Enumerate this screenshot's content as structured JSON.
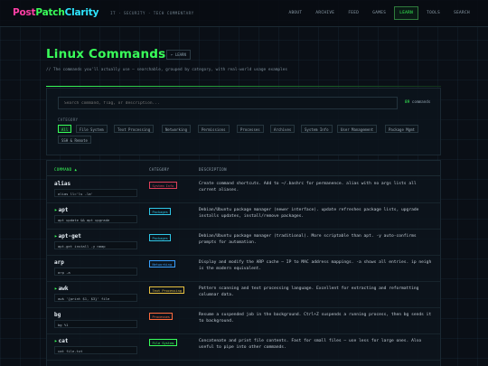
{
  "header": {
    "logo_parts": [
      "Post",
      "Patch",
      "Clarity"
    ],
    "tagline": "IT · SECURITY · TECH COMMENTARY",
    "nav": [
      "ABOUT",
      "ARCHIVE",
      "FEED",
      "GAMES",
      "LEARN",
      "TOOLS",
      "SEARCH"
    ],
    "active_nav": "LEARN"
  },
  "page": {
    "title": "Linux Commands",
    "crumb": "← LEARN",
    "subtitle": "// The commands you'll actually use — searchable, grouped by category, with real-world usage examples"
  },
  "search": {
    "placeholder": "Search command, flag, or description...",
    "count": "89",
    "count_label": "commands"
  },
  "categories": {
    "label": "CATEGORY",
    "items": [
      "All",
      "File System",
      "Text Processing",
      "Networking",
      "Permissions",
      "Processes",
      "Archives",
      "System Info",
      "User Management",
      "Package Mgmt",
      "SSH & Remote"
    ],
    "active": "All"
  },
  "table": {
    "headers": {
      "command": "COMMAND ▲",
      "category": "CATEGORY",
      "description": "DESCRIPTION"
    },
    "rows": [
      {
        "cmd": "alias",
        "arrow": "",
        "example": "alias ll='ls -la'",
        "category": "System Info",
        "color": "#e0405a",
        "desc": "Create command shortcuts. Add to ~/.bashrc for permanence. alias with no args lists all current aliases."
      },
      {
        "cmd": "apt",
        "arrow": "▸",
        "example": "apt update && apt upgrade",
        "category": "Packages",
        "color": "#2fc6e6",
        "desc": "Debian/Ubuntu package manager (newer interface). update refreshes package lists, upgrade installs updates, install/remove packages."
      },
      {
        "cmd": "apt-get",
        "arrow": "▸",
        "example": "apt-get install -y nmap",
        "category": "Packages",
        "color": "#2fc6e6",
        "desc": "Debian/Ubuntu package manager (traditional). More scriptable than apt. -y auto-confirms prompts for automation."
      },
      {
        "cmd": "arp",
        "arrow": "",
        "example": "arp -a",
        "category": "Networking",
        "color": "#3aa0ff",
        "desc": "Display and modify the ARP cache — IP to MAC address mappings. -a shows all entries. ip neigh is the modern equivalent."
      },
      {
        "cmd": "awk",
        "arrow": "▸",
        "example": "awk '{print $1, $3}' file",
        "category": "Text Processing",
        "color": "#e6c040",
        "desc": "Pattern scanning and text processing language. Excellent for extracting and reformatting columnar data."
      },
      {
        "cmd": "bg",
        "arrow": "",
        "example": "bg %1",
        "category": "Processes",
        "color": "#ff6a3d",
        "desc": "Resume a suspended job in the background. Ctrl+Z suspends a running process, then bg sends it to background."
      },
      {
        "cmd": "cat",
        "arrow": "▸",
        "example": "cat file.txt",
        "category": "File System",
        "color": "#39ff5a",
        "desc": "Concatenate and print file contents. Fast for small files — use less for large ones. Also useful to pipe into other commands."
      }
    ]
  },
  "colors": {
    "accent": "#39ff5a",
    "logo_pink": "#ff3fa4",
    "logo_cyan": "#2ee6ff",
    "background": "#0a0f16"
  }
}
